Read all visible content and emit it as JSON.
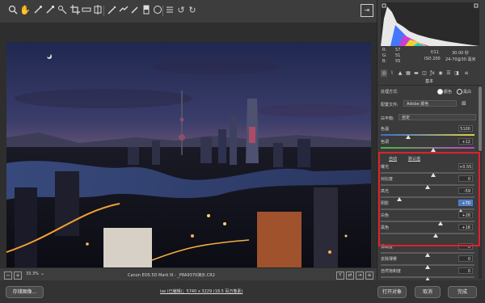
{
  "toolbar": {
    "icons": [
      "zoom-icon",
      "hand-icon",
      "white-balance-icon",
      "color-sampler-icon",
      "target-adjust-icon",
      "crop-icon",
      "straighten-icon",
      "transform-icon",
      "spot-removal-icon",
      "red-eye-icon",
      "adjustment-brush-icon",
      "graduated-filter-icon",
      "radial-filter-icon",
      "preferences-icon",
      "rotate-left-icon",
      "rotate-right-icon"
    ],
    "preview_icon": "preview-toggle-icon"
  },
  "status": {
    "zoom": "33.3%",
    "camera": "Canon EOS 5D Mark III - _P8A9370演示.CR2"
  },
  "bottom": {
    "save_label": "存储图像...",
    "workflow_link": "ise (已编辑)；5740 x 3229 (18.5 百万像素)",
    "open_label": "打开对象",
    "cancel_label": "取消",
    "done_label": "完成"
  },
  "info": {
    "r_label": "R:",
    "r_value": "57",
    "g_label": "G:",
    "g_value": "51",
    "b_label": "B:",
    "b_value": "55",
    "aperture": "f/11",
    "shutter": "30.00 秒",
    "iso": "ISO 200",
    "lens": "24-70@30 毫米"
  },
  "panel": {
    "title": "基本",
    "process_label": "处理方式:",
    "color_option": "颜色",
    "bw_option": "黑白",
    "profile_label": "配置文件:",
    "profile_value": "Adobe 颜色",
    "wb_label": "白平衡:",
    "wb_value": "自定",
    "auto_label": "自动",
    "default_label": "默认值",
    "sliders": [
      {
        "key": "temp",
        "label": "色温",
        "value": "5100",
        "level": 0.29
      },
      {
        "key": "tint",
        "label": "色调",
        "value": "+12",
        "level": 0.56
      },
      {
        "key": "exposure",
        "label": "曝光",
        "value": "+0.55",
        "level": 0.56
      },
      {
        "key": "contrast",
        "label": "对比度",
        "value": "0",
        "level": 0.5
      },
      {
        "key": "highlights",
        "label": "高光",
        "value": "-59",
        "level": 0.2
      },
      {
        "key": "shadows",
        "label": "阴影",
        "value": "+70",
        "level": 0.85
      },
      {
        "key": "whites",
        "label": "白色",
        "value": "+28",
        "level": 0.64
      },
      {
        "key": "blacks",
        "label": "黑色",
        "value": "+18",
        "level": 0.59
      },
      {
        "key": "clarity",
        "label": "清晰度",
        "value": "0",
        "level": 0.5
      },
      {
        "key": "dehaze",
        "label": "去除薄雾",
        "value": "0",
        "level": 0.5
      },
      {
        "key": "vibrance",
        "label": "自然饱和度",
        "value": "0",
        "level": 0.5
      }
    ]
  },
  "colors": {
    "highlight_box": "#e0202c",
    "active_field": "#5879a8"
  }
}
